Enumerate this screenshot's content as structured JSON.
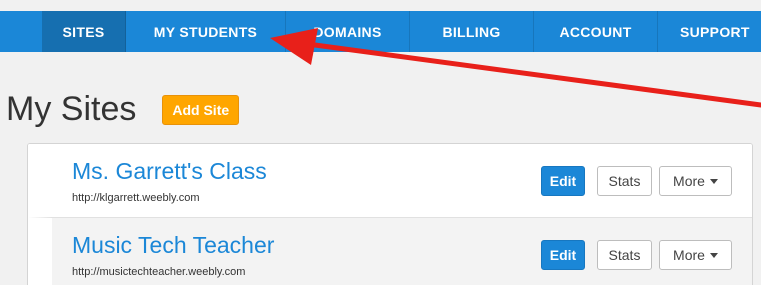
{
  "nav": {
    "items": [
      {
        "label": "SITES"
      },
      {
        "label": "MY STUDENTS"
      },
      {
        "label": "DOMAINS"
      },
      {
        "label": "BILLING"
      },
      {
        "label": "ACCOUNT"
      },
      {
        "label": "SUPPORT"
      }
    ],
    "active": "SITES"
  },
  "page": {
    "title": "My Sites",
    "add_site_label": "Add Site"
  },
  "sites": [
    {
      "name": "Ms. Garrett's Class",
      "url": "http://klgarrett.weebly.com",
      "edit": "Edit",
      "stats": "Stats",
      "more": "More"
    },
    {
      "name": "Music Tech Teacher",
      "url": "http://musictechteacher.weebly.com",
      "edit": "Edit",
      "stats": "Stats",
      "more": "More"
    }
  ],
  "colors": {
    "nav_bg": "#1b87d7",
    "nav_active": "#166fb0",
    "accent_orange": "#ffa600",
    "link_blue": "#1b87d7",
    "annotation_arrow": "#e8201a"
  }
}
